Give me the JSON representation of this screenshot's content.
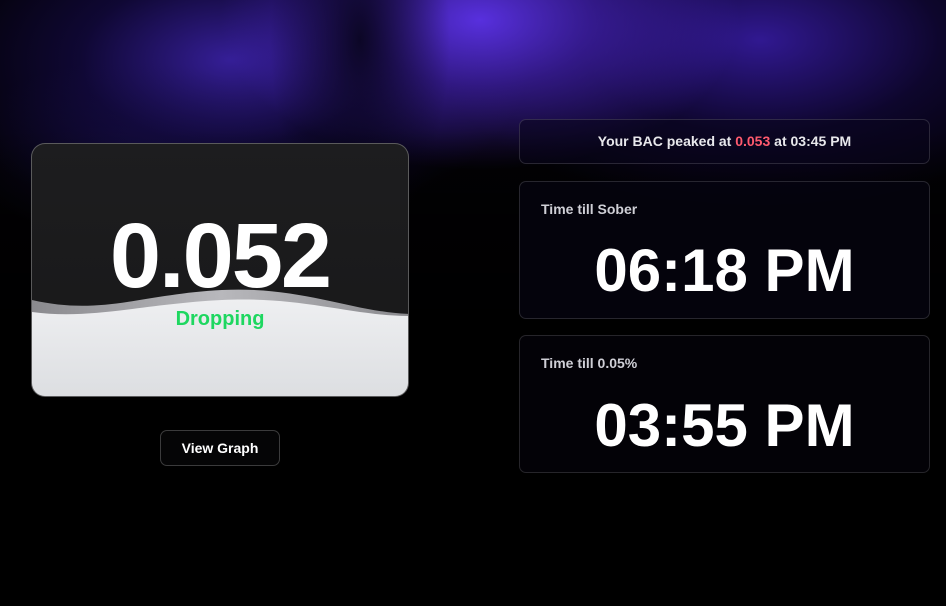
{
  "bac": {
    "value": "0.052",
    "status": "Dropping"
  },
  "actions": {
    "view_graph_label": "View Graph"
  },
  "peak": {
    "prefix": "Your BAC peaked at",
    "value": "0.053",
    "middle": "at",
    "time": "03:45 PM"
  },
  "sober": {
    "label": "Time till Sober",
    "time": "06:18 PM"
  },
  "limit": {
    "label": "Time till 0.05%",
    "time": "03:55 PM"
  },
  "colors": {
    "status_green": "#1ed760",
    "peak_red": "#ff5a6e",
    "accent_purple": "#5c32e8"
  }
}
